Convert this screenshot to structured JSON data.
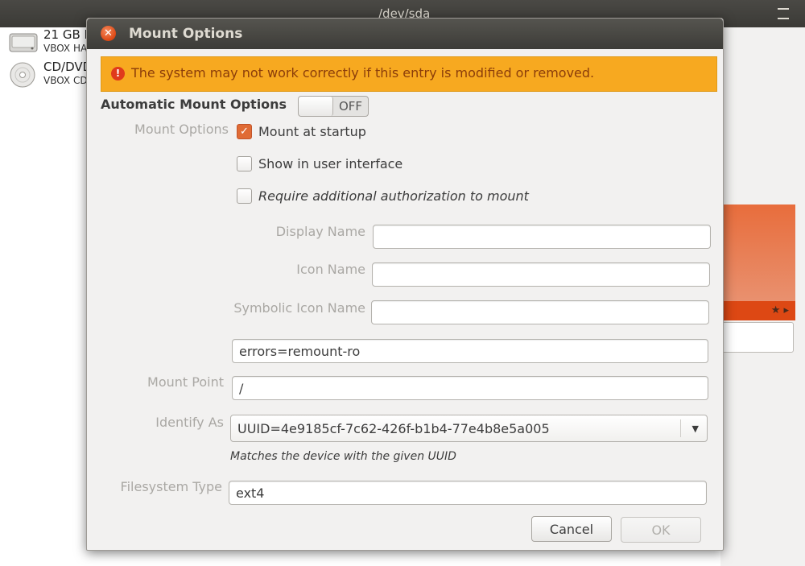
{
  "background": {
    "window_title": "/dev/sda",
    "drives": [
      {
        "line1": "21 GB D",
        "line2": "VBOX HA"
      },
      {
        "line1": "CD/DVD",
        "line2": "VBOX CD"
      }
    ]
  },
  "dialog": {
    "title": "Mount Options",
    "close_glyph": "✕",
    "warning": {
      "icon_glyph": "!",
      "text": "The system may not work correctly if this entry is modified or removed."
    },
    "automatic_mount": {
      "label": "Automatic Mount Options",
      "state": "OFF"
    },
    "mount_options_label": "Mount Options",
    "checkboxes": [
      {
        "label": "Mount at startup",
        "checked": true
      },
      {
        "label": "Show in user interface",
        "checked": false
      },
      {
        "label": "Require additional authorization to mount",
        "checked": false
      }
    ],
    "fields": {
      "display_name": {
        "label": "Display Name",
        "value": ""
      },
      "icon_name": {
        "label": "Icon Name",
        "value": ""
      },
      "symbolic_icon_name": {
        "label": "Symbolic Icon Name",
        "value": ""
      },
      "options": {
        "value": "errors=remount-ro"
      },
      "mount_point": {
        "label": "Mount Point",
        "value": "/"
      },
      "identify_as": {
        "label": "Identify As",
        "value": "UUID=4e9185cf-7c62-426f-b1b4-77e4b8e5a005",
        "hint": "Matches the device with the given UUID"
      },
      "filesystem_type": {
        "label": "Filesystem Type",
        "value": "ext4"
      }
    },
    "buttons": {
      "cancel": "Cancel",
      "ok": "OK"
    }
  },
  "colors": {
    "accent": "#dd4814",
    "warning_bg": "#f7a920",
    "title_bar": "#3c3b37"
  }
}
